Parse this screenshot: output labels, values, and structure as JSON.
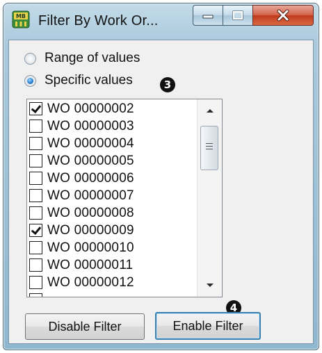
{
  "window": {
    "title": "Filter By Work Or...",
    "app_icon_text": "MB",
    "caption_buttons": [
      "minimize-icon",
      "maximize-icon",
      "close-icon"
    ]
  },
  "filter_mode": {
    "options": [
      {
        "label": "Range of values",
        "selected": false
      },
      {
        "label": "Specific values",
        "selected": true
      }
    ]
  },
  "annotations": {
    "marker_3": "3",
    "marker_4": "4"
  },
  "values_list": {
    "items": [
      {
        "label": "WO 00000002",
        "checked": true
      },
      {
        "label": "WO 00000003",
        "checked": false
      },
      {
        "label": "WO 00000004",
        "checked": false
      },
      {
        "label": "WO 00000005",
        "checked": false
      },
      {
        "label": "WO 00000006",
        "checked": false
      },
      {
        "label": "WO 00000007",
        "checked": false
      },
      {
        "label": "WO 00000008",
        "checked": false
      },
      {
        "label": "WO 00000009",
        "checked": true
      },
      {
        "label": "WO 00000010",
        "checked": false
      },
      {
        "label": "WO 00000011",
        "checked": false
      },
      {
        "label": "WO 00000012",
        "checked": false
      }
    ]
  },
  "buttons": {
    "disable_filter": "Disable Filter",
    "enable_filter": "Enable Filter"
  },
  "colors": {
    "frame": "#a9c9dc",
    "close_button": "#c03a1c",
    "radio_selected": "#2a7fcf",
    "default_button_border": "#3c7fb1"
  }
}
